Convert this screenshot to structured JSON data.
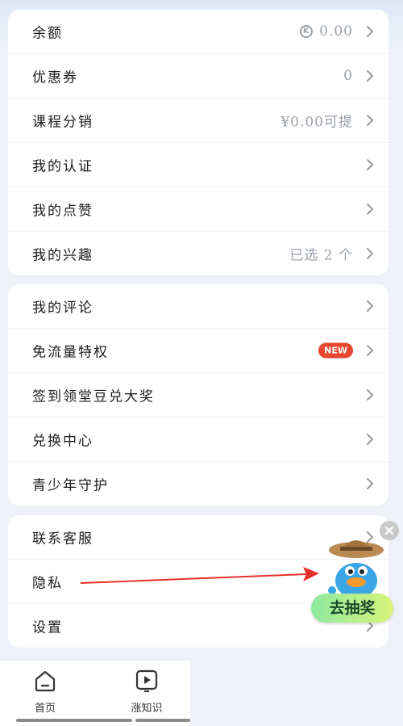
{
  "card1": [
    {
      "key": "balance",
      "label": "余额",
      "value": "0.00",
      "coin_icon": "coin-icon",
      "coin_glyph": "K"
    },
    {
      "key": "coupons",
      "label": "优惠券",
      "value": "0"
    },
    {
      "key": "course-distribution",
      "label": "课程分销",
      "value": "¥0.00可提"
    },
    {
      "key": "my-certification",
      "label": "我的认证",
      "value": ""
    },
    {
      "key": "my-likes",
      "label": "我的点赞",
      "value": ""
    },
    {
      "key": "my-interests",
      "label": "我的兴趣",
      "value": "已选 2 个"
    }
  ],
  "card2": [
    {
      "key": "my-comments",
      "label": "我的评论"
    },
    {
      "key": "free-data-privilege",
      "label": "免流量特权",
      "badge": "NEW"
    },
    {
      "key": "checkin-rewards",
      "label": "签到领堂豆兑大奖"
    },
    {
      "key": "exchange-center",
      "label": "兑换中心"
    },
    {
      "key": "youth-protection",
      "label": "青少年守护"
    }
  ],
  "card3": [
    {
      "key": "contact-support",
      "label": "联系客服"
    },
    {
      "key": "privacy",
      "label": "隐私"
    },
    {
      "key": "settings",
      "label": "设置"
    }
  ],
  "float_ad": {
    "button_label": "去抽奖",
    "close_icon": "close-icon",
    "mascot_icon": "duck-mascot-icon"
  },
  "annotation": {
    "arrow_color": "#e8302a"
  },
  "tabbar": {
    "tabs": [
      {
        "label": "首页",
        "icon": "home-icon"
      },
      {
        "label": "涨知识",
        "icon": "play-icon"
      }
    ]
  },
  "colors": {
    "background": "#eef2f8",
    "card": "#ffffff",
    "badge": "#e8462f",
    "muted_text": "#9aa0a8"
  }
}
